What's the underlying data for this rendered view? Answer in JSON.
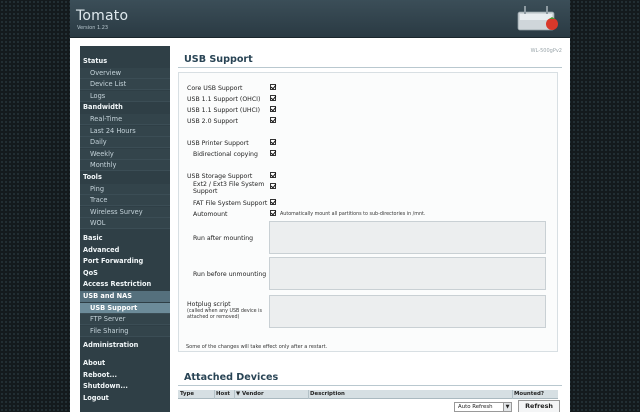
{
  "header": {
    "title": "Tomato",
    "version": "Version 1.23",
    "icon": "router-icon"
  },
  "sidebar": {
    "items": [
      {
        "label": "Status",
        "kind": "section"
      },
      {
        "label": "Overview",
        "kind": "sub"
      },
      {
        "label": "Device List",
        "kind": "sub"
      },
      {
        "label": "Logs",
        "kind": "sub"
      },
      {
        "label": "Bandwidth",
        "kind": "section"
      },
      {
        "label": "Real-Time",
        "kind": "sub"
      },
      {
        "label": "Last 24 Hours",
        "kind": "sub"
      },
      {
        "label": "Daily",
        "kind": "sub"
      },
      {
        "label": "Weekly",
        "kind": "sub"
      },
      {
        "label": "Monthly",
        "kind": "sub"
      },
      {
        "label": "Tools",
        "kind": "section"
      },
      {
        "label": "Ping",
        "kind": "sub"
      },
      {
        "label": "Trace",
        "kind": "sub"
      },
      {
        "label": "Wireless Survey",
        "kind": "sub"
      },
      {
        "label": "WOL",
        "kind": "sub"
      },
      {
        "label": "Basic",
        "kind": "section"
      },
      {
        "label": "Advanced",
        "kind": "section"
      },
      {
        "label": "Port Forwarding",
        "kind": "section"
      },
      {
        "label": "QoS",
        "kind": "section"
      },
      {
        "label": "Access Restriction",
        "kind": "section"
      },
      {
        "label": "USB and NAS",
        "kind": "section-active"
      },
      {
        "label": "USB Support",
        "kind": "sub-active"
      },
      {
        "label": "FTP Server",
        "kind": "sub"
      },
      {
        "label": "File Sharing",
        "kind": "sub"
      },
      {
        "label": "Administration",
        "kind": "section"
      },
      {
        "label": "About",
        "kind": "section"
      },
      {
        "label": "Reboot...",
        "kind": "section"
      },
      {
        "label": "Shutdown...",
        "kind": "section"
      },
      {
        "label": "Logout",
        "kind": "section"
      }
    ]
  },
  "main": {
    "hostname": "WL-500gPv2",
    "usb_title": "USB Support",
    "rows": {
      "core": "Core USB Support",
      "ohci": "USB 1.1 Support (OHCI)",
      "uhci": "USB 1.1 Support (UHCI)",
      "usb2": "USB 2.0 Support",
      "printer": "USB Printer Support",
      "bidir": "Bidirectional copying",
      "storage": "USB Storage Support",
      "ext": "Ext2 / Ext3 File System Support",
      "fat": "FAT File System Support",
      "automount": "Automount",
      "automount_help": "Automatically mount all partitions to sub-directories in /mnt.",
      "run_after": "Run after mounting",
      "run_before": "Run before unmounting",
      "hotplug": "Hotplug script",
      "hotplug_help": "(called when any USB device is attached or removed)"
    },
    "restart_note": "Some of the changes will take effect only after a restart.",
    "devices_title": "Attached Devices",
    "devices_columns": [
      "Type",
      "Host",
      "▼ Vendor",
      "Description",
      "Mounted?"
    ],
    "auto_refresh": "Auto Refresh",
    "refresh_label": "Refresh"
  }
}
